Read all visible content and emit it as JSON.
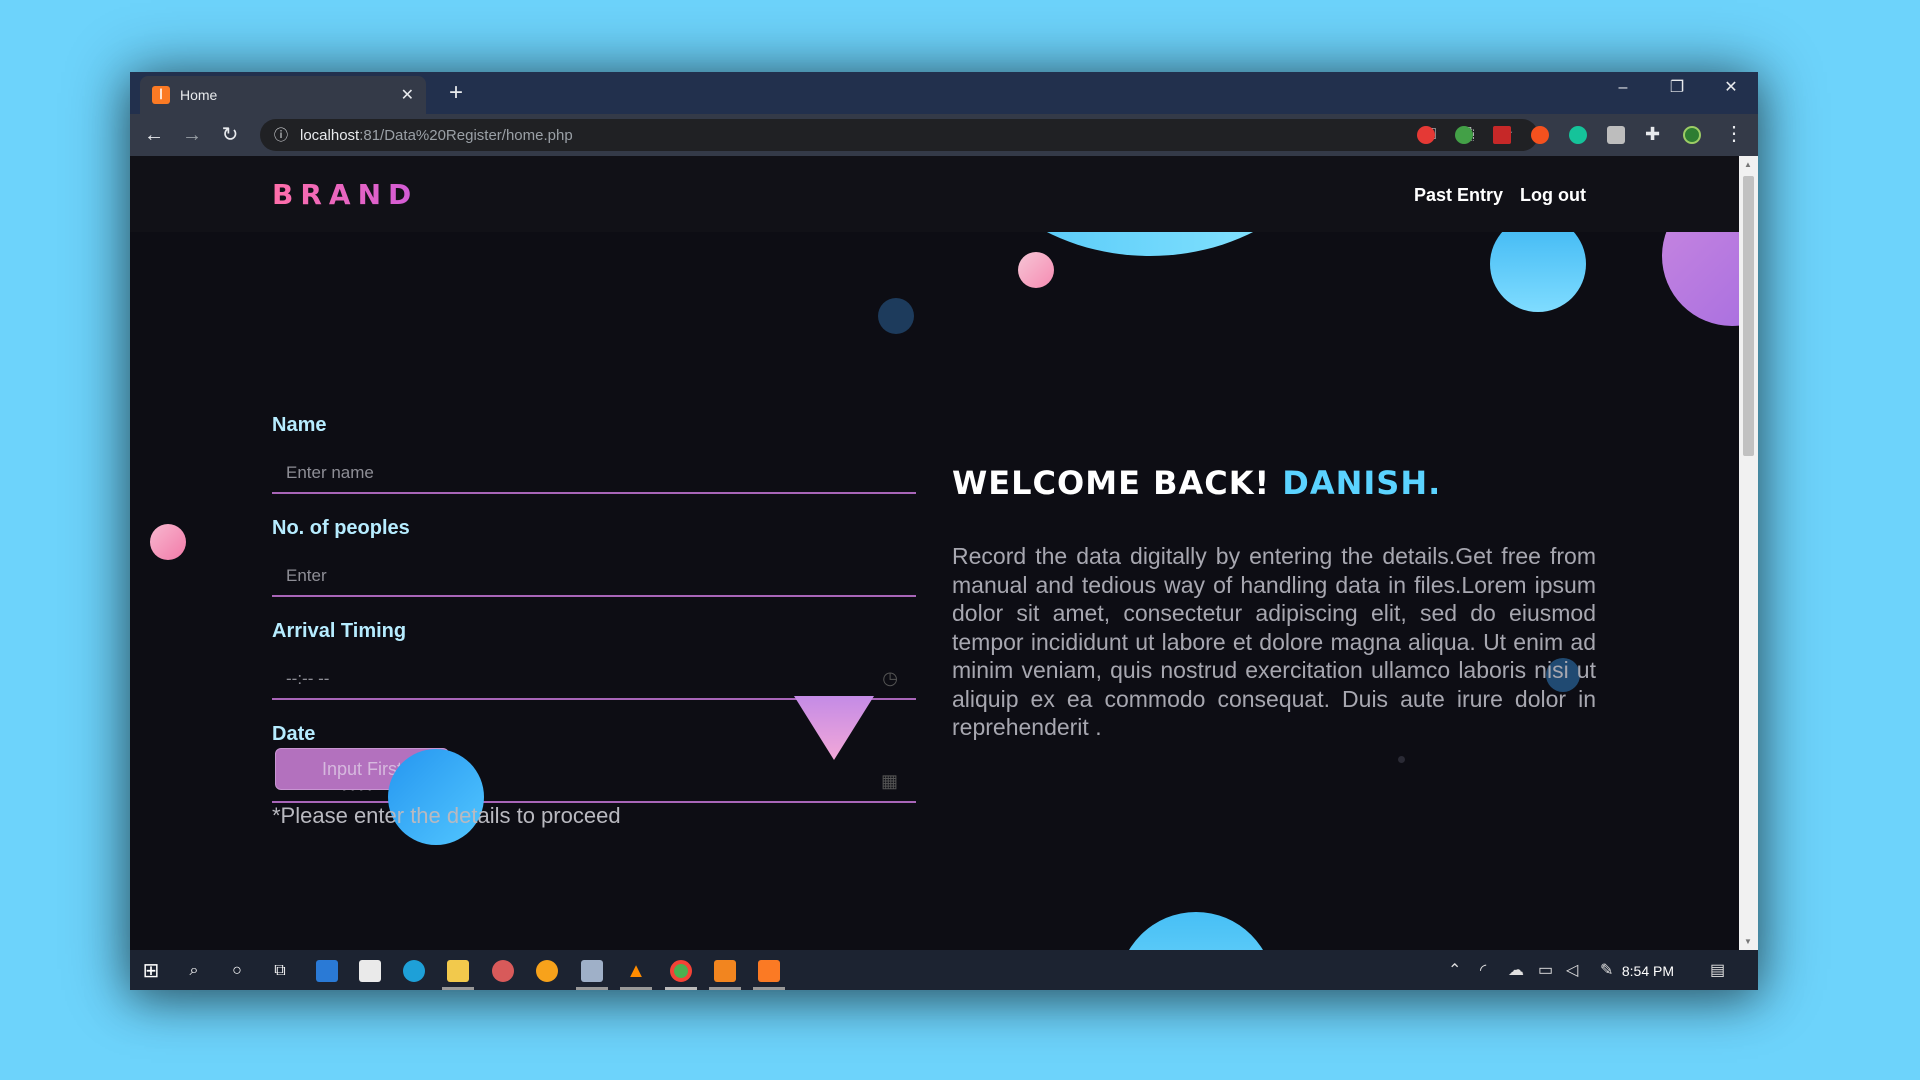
{
  "browser": {
    "tab_title": "Home",
    "tab_close": "✕",
    "new_tab": "+",
    "url_host": "localhost",
    "url_path": ":81/Data%20Register/home.php",
    "window_controls": [
      "–",
      "❐",
      "✕"
    ]
  },
  "site": {
    "brand": "BRAND",
    "nav": [
      "Past Entry",
      "Log out"
    ]
  },
  "form": {
    "name_label": "Name",
    "name_placeholder": "Enter name",
    "people_label": "No. of peoples",
    "people_placeholder": "Enter",
    "arrival_label": "Arrival Timing",
    "arrival_placeholder": "--:-- --",
    "date_label": "Date",
    "date_placeholder": "mm/dd/yyyy",
    "submit_label": "Input First",
    "hint": "*Please enter the details to proceed"
  },
  "welcome": {
    "heading": "WELCOME BACK!",
    "username": "DANISH.",
    "description": "Record the data digitally by entering the details.Get free from manual and tedious way of handling data in files.Lorem ipsum dolor sit amet, consectetur adipiscing elit, sed do eiusmod tempor incididunt ut labore et dolore magna aliqua. Ut enim ad minim veniam, quis nostrud exercitation ullamco laboris nisi ut aliquip ex ea commodo consequat. Duis aute irure dolor in reprehenderit ."
  },
  "taskbar": {
    "clock": "8:54 PM"
  },
  "colors": {
    "accent_blue": "#5bd3ff",
    "accent_pink": "#f06292",
    "form_label": "#b6ecff",
    "field_underline": "#a865b8"
  }
}
